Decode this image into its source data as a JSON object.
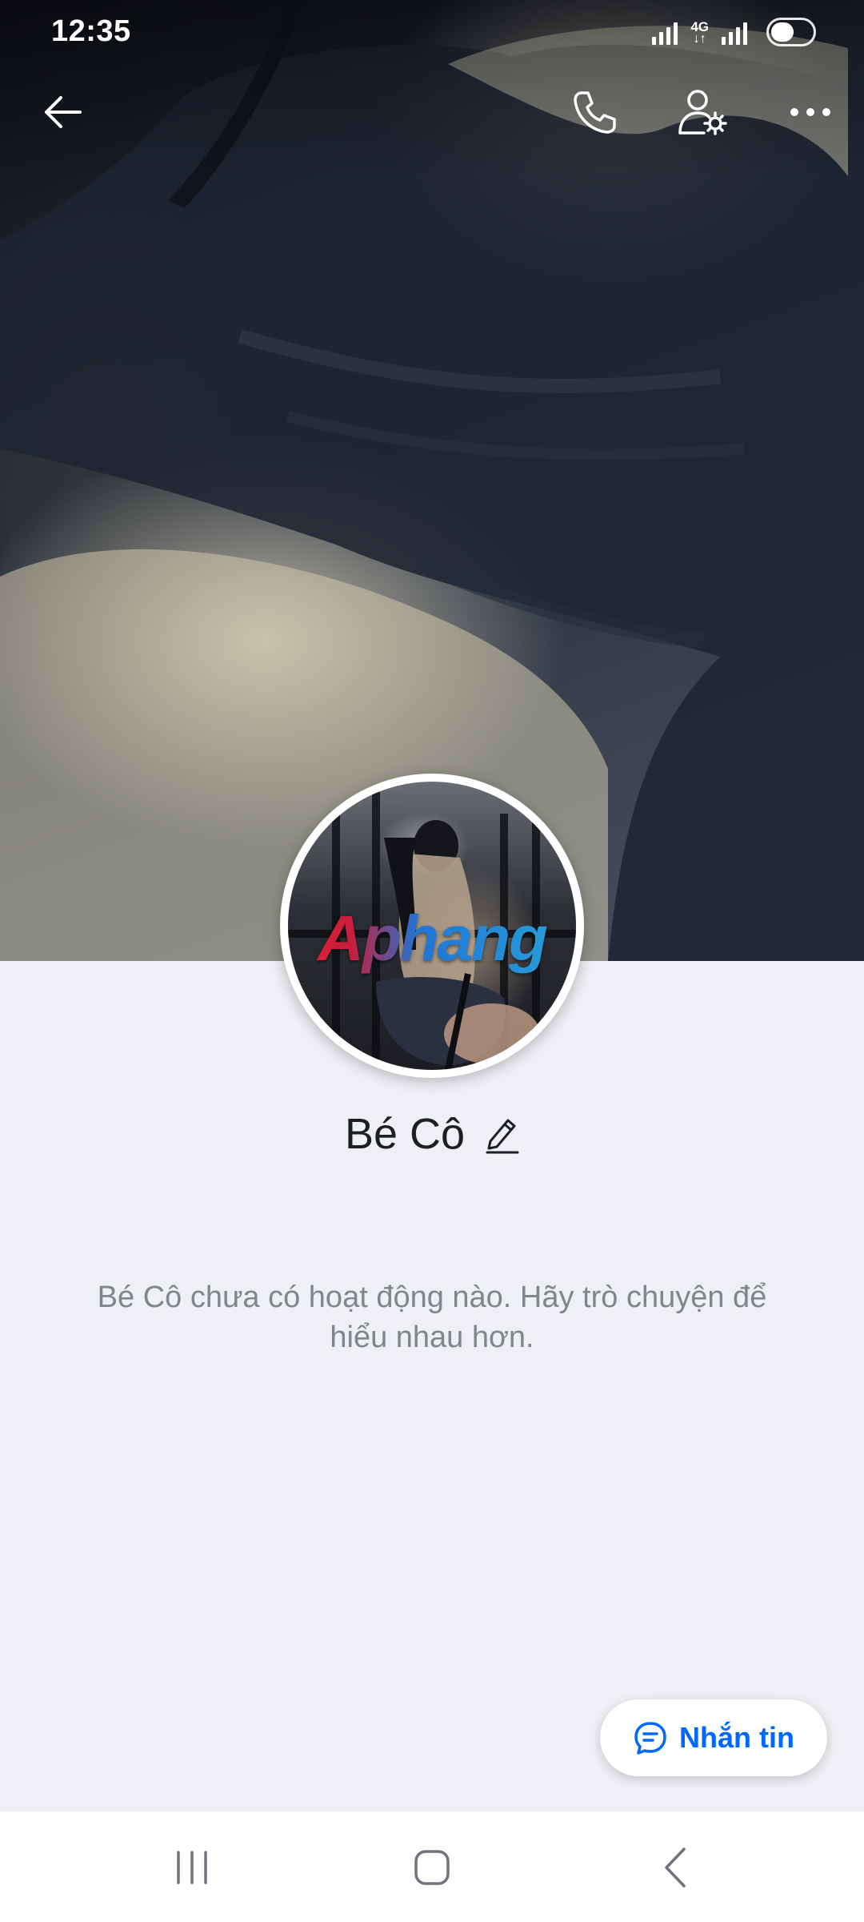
{
  "status_bar": {
    "time": "12:35",
    "network": "4G",
    "network_arrows": "↓↑",
    "battery_level": 0.55,
    "icons": [
      "signal-icon",
      "network-4g-icon",
      "signal-icon",
      "battery-icon"
    ]
  },
  "header": {
    "actions": [
      "back-arrow-icon",
      "phone-icon",
      "user-settings-icon",
      "more-icon"
    ]
  },
  "profile": {
    "name": "Bé Cô",
    "avatar_watermark": "Aphang",
    "edit_icon": "pencil-icon"
  },
  "empty_state": {
    "message": "Bé Cô chưa có hoạt động nào. Hãy trò chuyện để hiểu nhau hơn."
  },
  "message_button": {
    "label": "Nhắn tin",
    "icon": "chat-bubble-icon"
  },
  "nav_bar": {
    "buttons": [
      "recent-apps-icon",
      "home-icon",
      "back-icon"
    ]
  },
  "colors": {
    "accent": "#0068ff",
    "background": "#eff0f4",
    "name_text": "#1c1f24",
    "muted_text": "#7f8690"
  }
}
